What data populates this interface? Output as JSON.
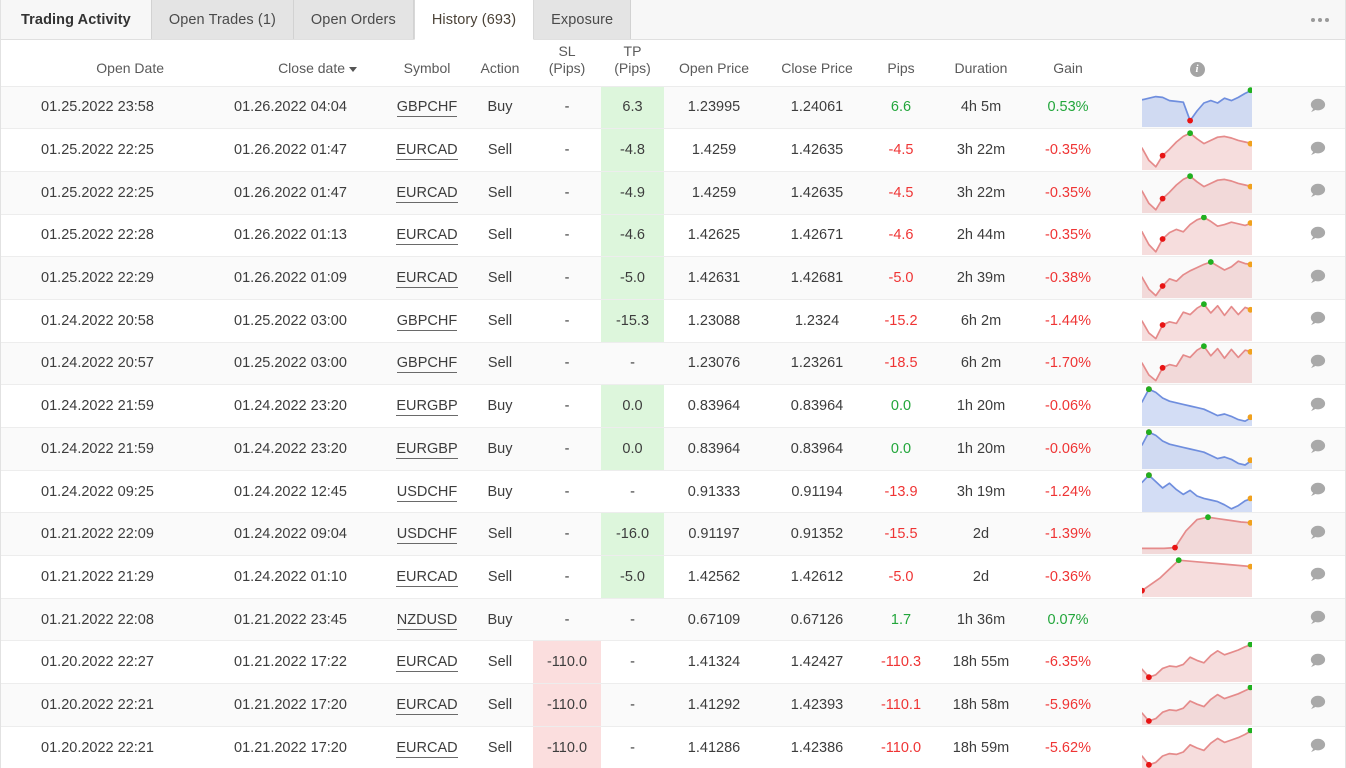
{
  "tabs": [
    {
      "label": "Trading Activity",
      "state": "header"
    },
    {
      "label": "Open Trades (1)",
      "state": "inactive"
    },
    {
      "label": "Open Orders",
      "state": "inactive"
    },
    {
      "label": "History (693)",
      "state": "active"
    },
    {
      "label": "Exposure",
      "state": "inactive"
    }
  ],
  "overflow_menu": "more-options",
  "colors": {
    "positive": "#22a63b",
    "negative": "#ef3434",
    "tp_cell_bg": "#ddf6dc",
    "sl_cell_bg": "#fbdede",
    "spark_up": "#6f8ede",
    "spark_down": "#e58b8b",
    "active_tab_text": "#4b4237"
  },
  "columns": [
    {
      "key": "open_date",
      "label": "Open Date",
      "label2": ""
    },
    {
      "key": "close_date",
      "label": "Close date",
      "label2": "",
      "sorted": true,
      "sort_dir": "desc"
    },
    {
      "key": "symbol",
      "label": "Symbol",
      "label2": ""
    },
    {
      "key": "action",
      "label": "Action",
      "label2": ""
    },
    {
      "key": "sl",
      "label": "SL",
      "label2": "(Pips)"
    },
    {
      "key": "tp",
      "label": "TP",
      "label2": "(Pips)"
    },
    {
      "key": "open_price",
      "label": "Open Price",
      "label2": ""
    },
    {
      "key": "close_price",
      "label": "Close Price",
      "label2": ""
    },
    {
      "key": "pips",
      "label": "Pips",
      "label2": ""
    },
    {
      "key": "duration",
      "label": "Duration",
      "label2": ""
    },
    {
      "key": "gain",
      "label": "Gain",
      "label2": ""
    },
    {
      "key": "chart",
      "label": "",
      "label2": "",
      "icon": "info-icon"
    },
    {
      "key": "note",
      "label": "",
      "label2": ""
    }
  ],
  "rows": [
    {
      "open_date": "01.25.2022 23:58",
      "close_date": "01.26.2022 04:04",
      "symbol": "GBPCHF",
      "action": "Buy",
      "sl": "-",
      "tp": "6.3",
      "open_price": "1.23995",
      "close_price": "1.24061",
      "pips": "6.6",
      "pips_sign": "pos",
      "duration": "4h 5m",
      "gain": "0.53%",
      "gain_sign": "pos",
      "tp_hl": "green",
      "sl_hl": "none",
      "spark": {
        "dir": "up",
        "points": [
          68,
          72,
          76,
          74,
          66,
          64,
          62,
          16,
          40,
          60,
          66,
          60,
          72,
          66,
          74,
          84,
          92
        ],
        "start_idx": 7,
        "peak_idx": 16,
        "end_marker": "green"
      }
    },
    {
      "open_date": "01.25.2022 22:25",
      "close_date": "01.26.2022 01:47",
      "symbol": "EURCAD",
      "action": "Sell",
      "sl": "-",
      "tp": "-4.8",
      "open_price": "1.4259",
      "close_price": "1.42635",
      "pips": "-4.5",
      "pips_sign": "neg",
      "duration": "3h 22m",
      "gain": "-0.35%",
      "gain_sign": "neg",
      "tp_hl": "green",
      "sl_hl": "none",
      "spark": {
        "dir": "down",
        "points": [
          55,
          24,
          8,
          36,
          52,
          70,
          84,
          92,
          78,
          66,
          74,
          82,
          84,
          80,
          74,
          70,
          66
        ],
        "start_idx": 3,
        "peak_idx": 7,
        "end_marker": "orange"
      }
    },
    {
      "open_date": "01.25.2022 22:25",
      "close_date": "01.26.2022 01:47",
      "symbol": "EURCAD",
      "action": "Sell",
      "sl": "-",
      "tp": "-4.9",
      "open_price": "1.4259",
      "close_price": "1.42635",
      "pips": "-4.5",
      "pips_sign": "neg",
      "duration": "3h 22m",
      "gain": "-0.35%",
      "gain_sign": "neg",
      "tp_hl": "green",
      "sl_hl": "none",
      "spark": {
        "dir": "down",
        "points": [
          55,
          24,
          8,
          36,
          52,
          70,
          84,
          92,
          78,
          66,
          74,
          82,
          84,
          80,
          74,
          70,
          66
        ],
        "start_idx": 3,
        "peak_idx": 7,
        "end_marker": "orange"
      }
    },
    {
      "open_date": "01.25.2022 22:28",
      "close_date": "01.26.2022 01:13",
      "symbol": "EURCAD",
      "action": "Sell",
      "sl": "-",
      "tp": "-4.6",
      "open_price": "1.42625",
      "close_price": "1.42671",
      "pips": "-4.6",
      "pips_sign": "neg",
      "duration": "2h 44m",
      "gain": "-0.35%",
      "gain_sign": "neg",
      "tp_hl": "green",
      "sl_hl": "none",
      "spark": {
        "dir": "down",
        "points": [
          58,
          26,
          8,
          40,
          56,
          64,
          58,
          76,
          88,
          94,
          84,
          72,
          76,
          82,
          78,
          74,
          80
        ],
        "start_idx": 3,
        "peak_idx": 9,
        "end_marker": "orange"
      }
    },
    {
      "open_date": "01.25.2022 22:29",
      "close_date": "01.26.2022 01:09",
      "symbol": "EURCAD",
      "action": "Sell",
      "sl": "-",
      "tp": "-5.0",
      "open_price": "1.42631",
      "close_price": "1.42681",
      "pips": "-5.0",
      "pips_sign": "neg",
      "duration": "2h 39m",
      "gain": "-0.38%",
      "gain_sign": "neg",
      "tp_hl": "green",
      "sl_hl": "none",
      "spark": {
        "dir": "down",
        "points": [
          52,
          22,
          6,
          30,
          48,
          42,
          58,
          68,
          76,
          84,
          90,
          80,
          70,
          78,
          92,
          86,
          84
        ],
        "start_idx": 3,
        "peak_idx": 10,
        "end_marker": "orange"
      }
    },
    {
      "open_date": "01.24.2022 20:58",
      "close_date": "01.25.2022 03:00",
      "symbol": "GBPCHF",
      "action": "Sell",
      "sl": "-",
      "tp": "-15.3",
      "open_price": "1.23088",
      "close_price": "1.2324",
      "pips": "-15.2",
      "pips_sign": "neg",
      "duration": "6h 2m",
      "gain": "-1.44%",
      "gain_sign": "neg",
      "tp_hl": "green",
      "sl_hl": "none",
      "spark": {
        "dir": "down",
        "points": [
          50,
          20,
          6,
          40,
          48,
          44,
          72,
          66,
          82,
          92,
          70,
          88,
          64,
          86,
          66,
          84,
          78
        ],
        "start_idx": 3,
        "peak_idx": 9,
        "end_marker": "orange"
      }
    },
    {
      "open_date": "01.24.2022 20:57",
      "close_date": "01.25.2022 03:00",
      "symbol": "GBPCHF",
      "action": "Sell",
      "sl": "-",
      "tp": "-",
      "open_price": "1.23076",
      "close_price": "1.23261",
      "pips": "-18.5",
      "pips_sign": "neg",
      "duration": "6h 2m",
      "gain": "-1.70%",
      "gain_sign": "neg",
      "tp_hl": "none",
      "sl_hl": "none",
      "spark": {
        "dir": "down",
        "points": [
          50,
          20,
          6,
          38,
          46,
          42,
          70,
          64,
          82,
          92,
          68,
          86,
          62,
          84,
          64,
          82,
          78
        ],
        "start_idx": 3,
        "peak_idx": 9,
        "end_marker": "orange"
      }
    },
    {
      "open_date": "01.24.2022 21:59",
      "close_date": "01.24.2022 23:20",
      "symbol": "EURGBP",
      "action": "Buy",
      "sl": "-",
      "tp": "0.0",
      "open_price": "0.83964",
      "close_price": "0.83964",
      "pips": "0.0",
      "pips_sign": "pos",
      "duration": "1h 20m",
      "gain": "-0.06%",
      "gain_sign": "neg",
      "tp_hl": "green",
      "sl_hl": "none",
      "spark": {
        "dir": "up",
        "points": [
          60,
          92,
          84,
          70,
          62,
          58,
          54,
          50,
          46,
          42,
          34,
          26,
          30,
          24,
          16,
          12,
          22
        ],
        "start_idx": 1,
        "peak_idx": 1,
        "end_marker": "orange"
      }
    },
    {
      "open_date": "01.24.2022 21:59",
      "close_date": "01.24.2022 23:20",
      "symbol": "EURGBP",
      "action": "Buy",
      "sl": "-",
      "tp": "0.0",
      "open_price": "0.83964",
      "close_price": "0.83964",
      "pips": "0.0",
      "pips_sign": "pos",
      "duration": "1h 20m",
      "gain": "-0.06%",
      "gain_sign": "neg",
      "tp_hl": "green",
      "sl_hl": "none",
      "spark": {
        "dir": "up",
        "points": [
          60,
          92,
          84,
          70,
          62,
          58,
          54,
          50,
          46,
          42,
          34,
          26,
          30,
          24,
          14,
          10,
          22
        ],
        "start_idx": 1,
        "peak_idx": 1,
        "end_marker": "orange"
      }
    },
    {
      "open_date": "01.24.2022 09:25",
      "close_date": "01.24.2022 12:45",
      "symbol": "USDCHF",
      "action": "Buy",
      "sl": "-",
      "tp": "-",
      "open_price": "0.91333",
      "close_price": "0.91194",
      "pips": "-13.9",
      "pips_sign": "neg",
      "duration": "3h 19m",
      "gain": "-1.24%",
      "gain_sign": "neg",
      "tp_hl": "none",
      "sl_hl": "none",
      "spark": {
        "dir": "up",
        "points": [
          74,
          92,
          76,
          60,
          72,
          56,
          44,
          54,
          40,
          34,
          30,
          26,
          18,
          8,
          16,
          28,
          34
        ],
        "start_idx": 1,
        "peak_idx": 1,
        "end_marker": "orange"
      }
    },
    {
      "open_date": "01.21.2022 22:09",
      "close_date": "01.24.2022 09:04",
      "symbol": "USDCHF",
      "action": "Sell",
      "sl": "-",
      "tp": "-16.0",
      "open_price": "0.91197",
      "close_price": "0.91352",
      "pips": "-15.5",
      "pips_sign": "neg",
      "duration": "2d",
      "gain": "-1.39%",
      "gain_sign": "neg",
      "tp_hl": "green",
      "sl_hl": "none",
      "spark": {
        "dir": "down",
        "points": [
          14,
          14,
          14,
          16,
          58,
          86,
          92,
          88,
          84,
          80,
          78
        ],
        "start_idx": 3,
        "peak_idx": 6,
        "end_marker": "orange"
      }
    },
    {
      "open_date": "01.21.2022 21:29",
      "close_date": "01.24.2022 01:10",
      "symbol": "EURCAD",
      "action": "Sell",
      "sl": "-",
      "tp": "-5.0",
      "open_price": "1.42562",
      "close_price": "1.42612",
      "pips": "-5.0",
      "pips_sign": "neg",
      "duration": "2d",
      "gain": "-0.36%",
      "gain_sign": "neg",
      "tp_hl": "green",
      "sl_hl": "none",
      "spark": {
        "dir": "down",
        "points": [
          16,
          48,
          92,
          88,
          84,
          80,
          76
        ],
        "start_idx": 0,
        "peak_idx": 2,
        "end_marker": "orange"
      }
    },
    {
      "open_date": "01.21.2022 22:08",
      "close_date": "01.21.2022 23:45",
      "symbol": "NZDUSD",
      "action": "Buy",
      "sl": "-",
      "tp": "-",
      "open_price": "0.67109",
      "close_price": "0.67126",
      "pips": "1.7",
      "pips_sign": "pos",
      "duration": "1h 36m",
      "gain": "0.07%",
      "gain_sign": "pos",
      "tp_hl": "none",
      "sl_hl": "none",
      "spark": null
    },
    {
      "open_date": "01.20.2022 22:27",
      "close_date": "01.21.2022 17:22",
      "symbol": "EURCAD",
      "action": "Sell",
      "sl": "-110.0",
      "tp": "-",
      "open_price": "1.41324",
      "close_price": "1.42427",
      "pips": "-110.3",
      "pips_sign": "neg",
      "duration": "18h 55m",
      "gain": "-6.35%",
      "gain_sign": "neg",
      "tp_hl": "none",
      "sl_hl": "red",
      "spark": {
        "dir": "down",
        "points": [
          32,
          12,
          18,
          34,
          40,
          38,
          44,
          62,
          54,
          48,
          66,
          78,
          68,
          74,
          80,
          88,
          94
        ],
        "start_idx": 1,
        "peak_idx": 16,
        "end_marker": "green"
      }
    },
    {
      "open_date": "01.20.2022 22:21",
      "close_date": "01.21.2022 17:20",
      "symbol": "EURCAD",
      "action": "Sell",
      "sl": "-110.0",
      "tp": "-",
      "open_price": "1.41292",
      "close_price": "1.42393",
      "pips": "-110.1",
      "pips_sign": "neg",
      "duration": "18h 58m",
      "gain": "-5.96%",
      "gain_sign": "neg",
      "tp_hl": "none",
      "sl_hl": "red",
      "spark": {
        "dir": "down",
        "points": [
          30,
          10,
          16,
          32,
          38,
          36,
          42,
          60,
          52,
          46,
          64,
          76,
          66,
          72,
          78,
          86,
          94
        ],
        "start_idx": 1,
        "peak_idx": 16,
        "end_marker": "green"
      }
    },
    {
      "open_date": "01.20.2022 22:21",
      "close_date": "01.21.2022 17:20",
      "symbol": "EURCAD",
      "action": "Sell",
      "sl": "-110.0",
      "tp": "-",
      "open_price": "1.41286",
      "close_price": "1.42386",
      "pips": "-110.0",
      "pips_sign": "neg",
      "duration": "18h 59m",
      "gain": "-5.62%",
      "gain_sign": "neg",
      "tp_hl": "none",
      "sl_hl": "red",
      "spark": {
        "dir": "down",
        "points": [
          30,
          8,
          14,
          30,
          36,
          34,
          40,
          58,
          50,
          44,
          62,
          74,
          64,
          70,
          76,
          84,
          94
        ],
        "start_idx": 1,
        "peak_idx": 16,
        "end_marker": "green"
      }
    }
  ]
}
